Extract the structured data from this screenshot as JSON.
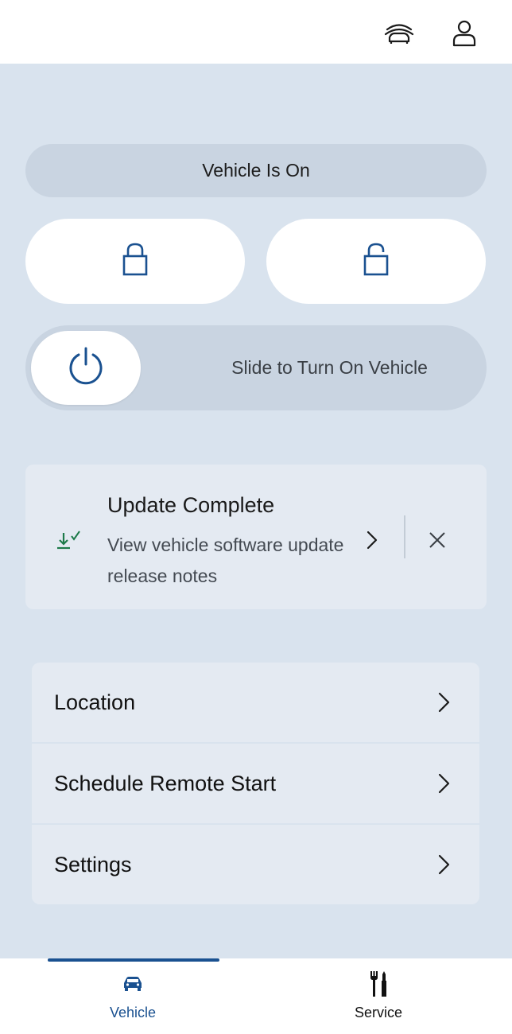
{
  "header": {
    "icons": [
      "garage-car-icon",
      "profile-icon"
    ]
  },
  "vehicle_status": {
    "label": "Vehicle Is On"
  },
  "lock_controls": {
    "lock_icon": "lock-icon",
    "unlock_icon": "unlock-icon"
  },
  "remote_start": {
    "slider_label": "Slide to Turn On Vehicle",
    "knob_icon": "power-icon"
  },
  "update_notice": {
    "title": "Update Complete",
    "description": "View vehicle software update release notes",
    "icon": "download-check-icon"
  },
  "menu": {
    "items": [
      {
        "label": "Location"
      },
      {
        "label": "Schedule Remote Start"
      },
      {
        "label": "Settings"
      }
    ]
  },
  "bottom_nav": {
    "tabs": [
      {
        "label": "Vehicle",
        "icon": "car-icon",
        "active": true
      },
      {
        "label": "Service",
        "icon": "tools-icon",
        "active": false
      }
    ]
  },
  "colors": {
    "accent": "#1a5190",
    "background": "#d9e3ee",
    "card": "#e4eaf2",
    "pill": "#c9d4e1",
    "success": "#1d7a4a"
  }
}
